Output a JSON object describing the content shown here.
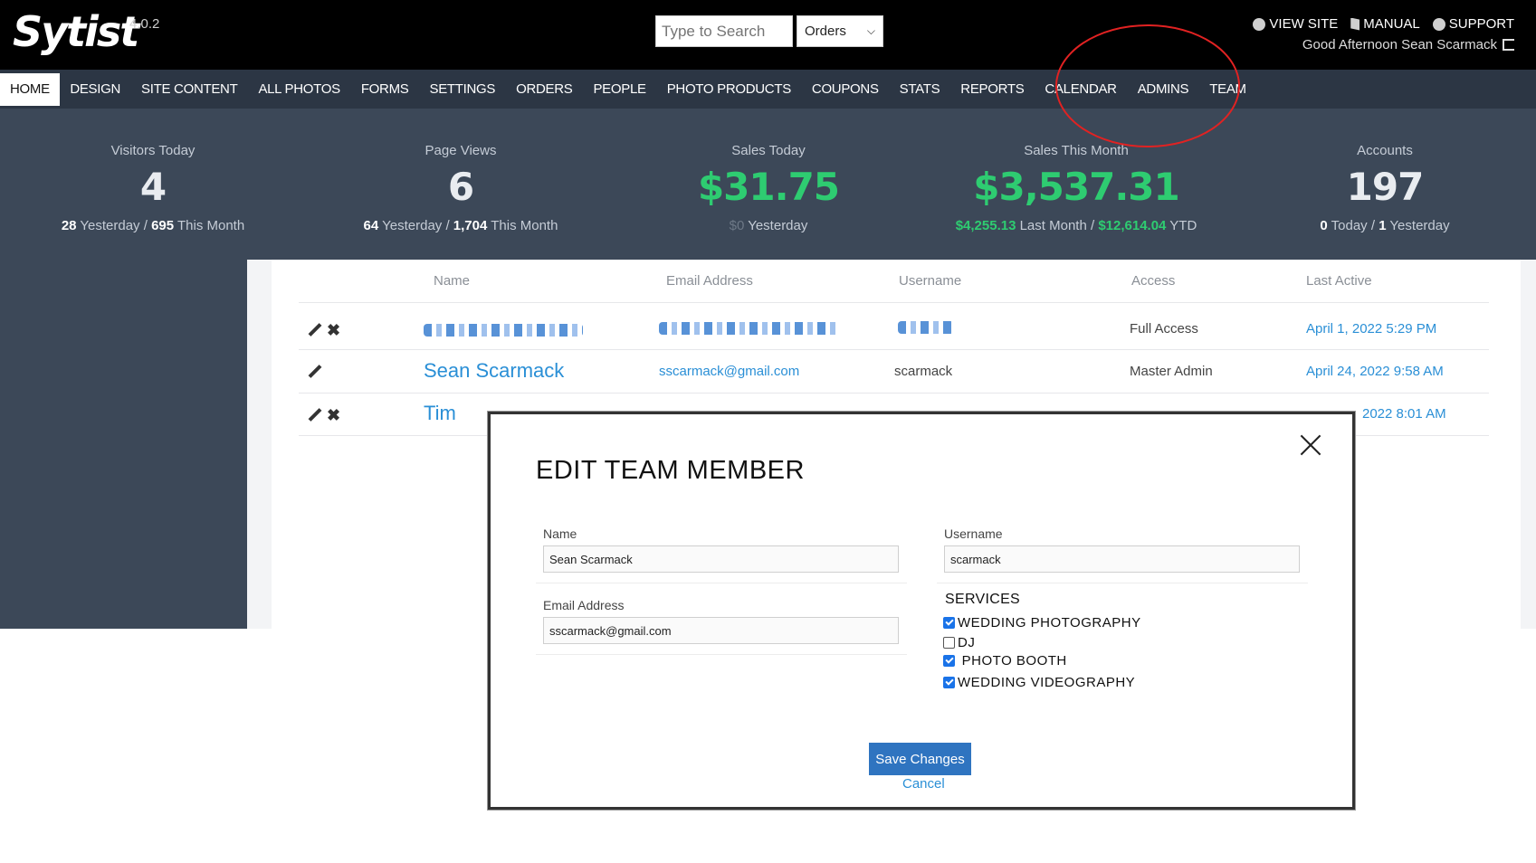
{
  "header": {
    "logo": "Sytist",
    "version": "4.0.2",
    "search_placeholder": "Type to Search",
    "search_scope": "Orders",
    "links": {
      "view_site": "VIEW SITE",
      "manual": "MANUAL",
      "support": "SUPPORT"
    },
    "greeting": "Good Afternoon Sean Scarmack"
  },
  "nav": [
    "HOME",
    "DESIGN",
    "SITE CONTENT",
    "ALL PHOTOS",
    "FORMS",
    "SETTINGS",
    "ORDERS",
    "PEOPLE",
    "PHOTO PRODUCTS",
    "COUPONS",
    "STATS",
    "REPORTS",
    "CALENDAR",
    "ADMINS",
    "TEAM"
  ],
  "stats": {
    "visitors": {
      "label": "Visitors Today",
      "value": "4",
      "sub_a": "28",
      "sub_a_text": " Yesterday / ",
      "sub_b": "695",
      "sub_b_text": " This Month"
    },
    "pageviews": {
      "label": "Page Views",
      "value": "6",
      "sub_a": "64",
      "sub_a_text": " Yesterday / ",
      "sub_b": "1,704",
      "sub_b_text": " This Month"
    },
    "sales_today": {
      "label": "Sales Today",
      "value": "$31.75",
      "sub_a": "$0",
      "sub_a_text": " Yesterday"
    },
    "sales_month": {
      "label": "Sales This Month",
      "value": "$3,537.31",
      "sub_a": "$4,255.13",
      "sub_a_text": " Last Month / ",
      "sub_b": "$12,614.04",
      "sub_b_text": " YTD"
    },
    "accounts": {
      "label": "Accounts",
      "value": "197",
      "sub_a": "0",
      "sub_a_text": " Today / ",
      "sub_b": "1",
      "sub_b_text": " Yesterday"
    }
  },
  "table": {
    "headers": {
      "name": "Name",
      "email": "Email Address",
      "username": "Username",
      "access": "Access",
      "last_active": "Last Active"
    },
    "rows": [
      {
        "name": "",
        "email": "",
        "username": "",
        "access": "Full Access",
        "last_active": "April 1, 2022 5:29 PM"
      },
      {
        "name": "Sean Scarmack",
        "email": "sscarmack@gmail.com",
        "username": "scarmack",
        "access": "Master Admin",
        "last_active": "April 24, 2022 9:58 AM"
      },
      {
        "name": "Tim",
        "email": "",
        "username": "",
        "access": "",
        "last_active": "2022 8:01 AM"
      }
    ]
  },
  "modal": {
    "title": "EDIT TEAM MEMBER",
    "name_label": "Name",
    "name_value": "Sean Scarmack",
    "username_label": "Username",
    "username_value": "scarmack",
    "email_label": "Email Address",
    "email_value": "sscarmack@gmail.com",
    "services_title": "SERVICES",
    "services": [
      {
        "label": "WEDDING PHOTOGRAPHY",
        "checked": true
      },
      {
        "label": "DJ",
        "checked": false
      },
      {
        "label": " PHOTO BOOTH",
        "checked": true
      },
      {
        "label": "WEDDING VIDEOGRAPHY",
        "checked": true
      }
    ],
    "save_label": "Save Changes",
    "cancel_label": "Cancel"
  },
  "colors": {
    "accent_green": "#2ecc71",
    "link_blue": "#2a8fd6",
    "nav_bg": "#2c3644",
    "stats_bg": "#3c4858",
    "annotation_red": "#e12222"
  }
}
